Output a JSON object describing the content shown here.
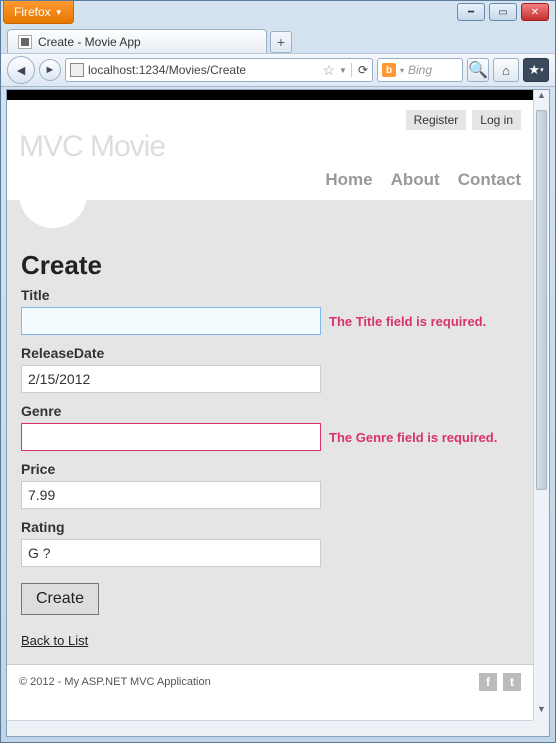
{
  "browser": {
    "name": "Firefox",
    "tab_title": "Create - Movie App",
    "url": "localhost:1234/Movies/Create",
    "search_placeholder": "Bing"
  },
  "header": {
    "register": "Register",
    "login": "Log in",
    "logo": "MVC Movie",
    "nav": {
      "home": "Home",
      "about": "About",
      "contact": "Contact"
    }
  },
  "form": {
    "heading": "Create",
    "fields": {
      "title": {
        "label": "Title",
        "value": "",
        "error": "The Title field is required."
      },
      "releaseDate": {
        "label": "ReleaseDate",
        "value": "2/15/2012",
        "error": ""
      },
      "genre": {
        "label": "Genre",
        "value": "",
        "error": "The Genre field is required."
      },
      "price": {
        "label": "Price",
        "value": "7.99",
        "error": ""
      },
      "rating": {
        "label": "Rating",
        "value": "G ?",
        "error": ""
      }
    },
    "submit": "Create",
    "back": "Back to List"
  },
  "footer": {
    "copyright": "© 2012 - My ASP.NET MVC Application"
  }
}
